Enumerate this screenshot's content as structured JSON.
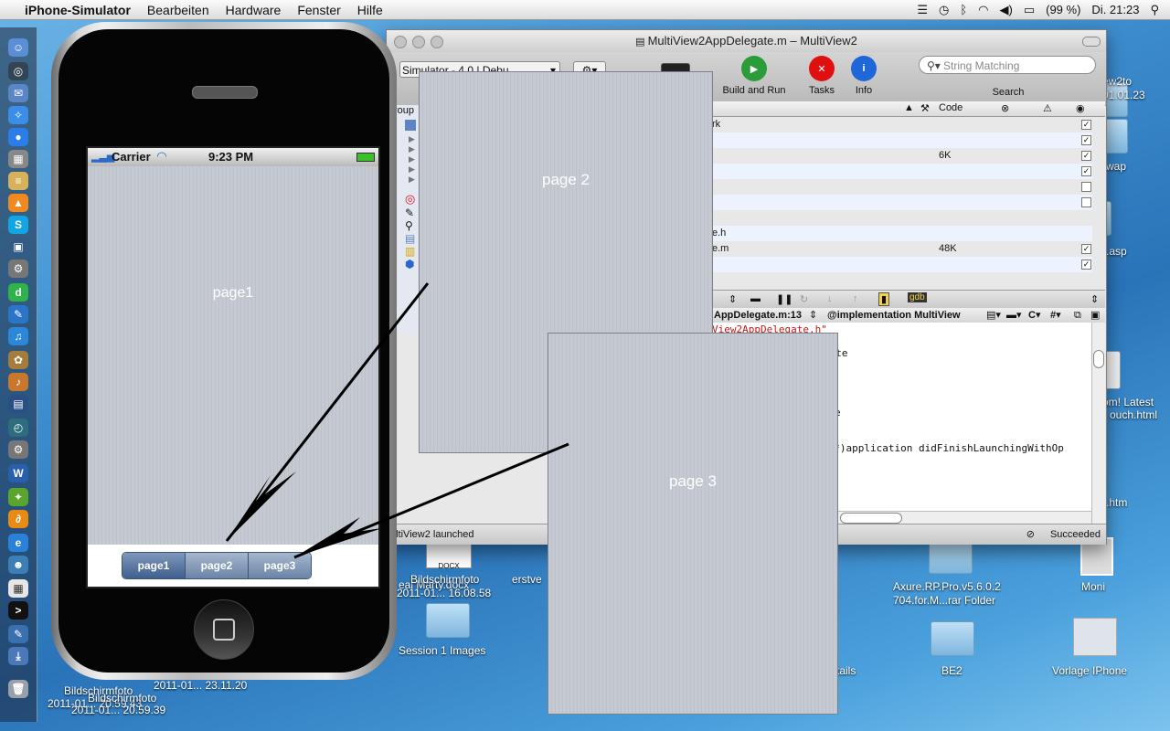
{
  "menubar": {
    "apple": "",
    "app_name": "iPhone-Simulator",
    "items": [
      "Bearbeiten",
      "Hardware",
      "Fenster",
      "Hilfe"
    ],
    "battery": "(99 %)",
    "clock": "Di. 21:23"
  },
  "xcode": {
    "title": "MultiView2AppDelegate.m – MultiView2",
    "overview": "Simulator - 4.0 | Debu",
    "toolbar": {
      "build_and_run": "Build and Run",
      "tasks": "Tasks",
      "info": "Info",
      "search_placeholder": "String Matching",
      "search_label": "Search"
    },
    "groups_label": "roup",
    "table_header_code": "Code",
    "rows": [
      {
        "name": "rk",
        "code": "",
        "checked": true
      },
      {
        "name": "",
        "code": "",
        "checked": true
      },
      {
        "name": "",
        "code": "6K",
        "checked": true
      },
      {
        "name": "",
        "code": "",
        "checked": true
      },
      {
        "name": "",
        "code": "",
        "checked": false
      },
      {
        "name": "",
        "code": "",
        "checked": false
      },
      {
        "name": "",
        "code": "",
        "checked": null
      },
      {
        "name": "e.h",
        "code": "",
        "checked": null
      },
      {
        "name": "e.m",
        "code": "48K",
        "checked": true
      },
      {
        "name": "",
        "code": "",
        "checked": true
      }
    ],
    "editor_file": "AppDelegate.m:13",
    "editor_symbol": "@implementation MultiView",
    "code_lines": [
      "View2AppDelegate.h\"",
      "",
      "gate",
      "",
      "",
      "",
      "",
      "e",
      "",
      "",
      "n *)application didFinishLaunchingWithOp"
    ],
    "status_left": "ultiView2 launched",
    "status_right": "Succeeded"
  },
  "iphone": {
    "carrier": "Carrier",
    "time": "9:23 PM",
    "content_label": "page1",
    "segments": [
      "page1",
      "page2",
      "page3"
    ],
    "selected_segment": 0
  },
  "cards": {
    "page2": "page 2",
    "page3": "page 3"
  },
  "desktop": {
    "labels": {
      "bildschirmfoto_top": "Bildschirmfoto",
      "bildschirmfoto_date": "2011-01... 16.08.58",
      "erstve": "erstve",
      "docx": "eal Marty.docx",
      "session": "Session 1 Images",
      "axure_1": "Axure.RP.Pro.v5.6.0.2",
      "axure_2": "704.for.M...rar Folder",
      "moni": "Moni",
      "be2": "BE2",
      "tails": "tails",
      "vorlage": "Vorlage IPhone",
      "ew2to": "ew2to",
      "date_tr": "01.01.23",
      "wap": "wap",
      "asp": ".asp",
      "latest_1": "om! Latest",
      "latest_2": "ouch.html",
      "htm": ".htm",
      "bottom_1": "Bildschirmfoto",
      "bottom_2": "2011-01... 20.59.43",
      "bottom_3": "Bildschirmfoto",
      "bottom_4": "2011-01... 20.59.39",
      "bottom_5": "2011-01... 23.11.20"
    }
  },
  "colors": {
    "segment_selected": "#3f5f8f",
    "segment_normal": "#6b84a6",
    "page_bg": "#c5cad2",
    "build_icon": "#e01010",
    "info_icon": "#1f66d8"
  }
}
